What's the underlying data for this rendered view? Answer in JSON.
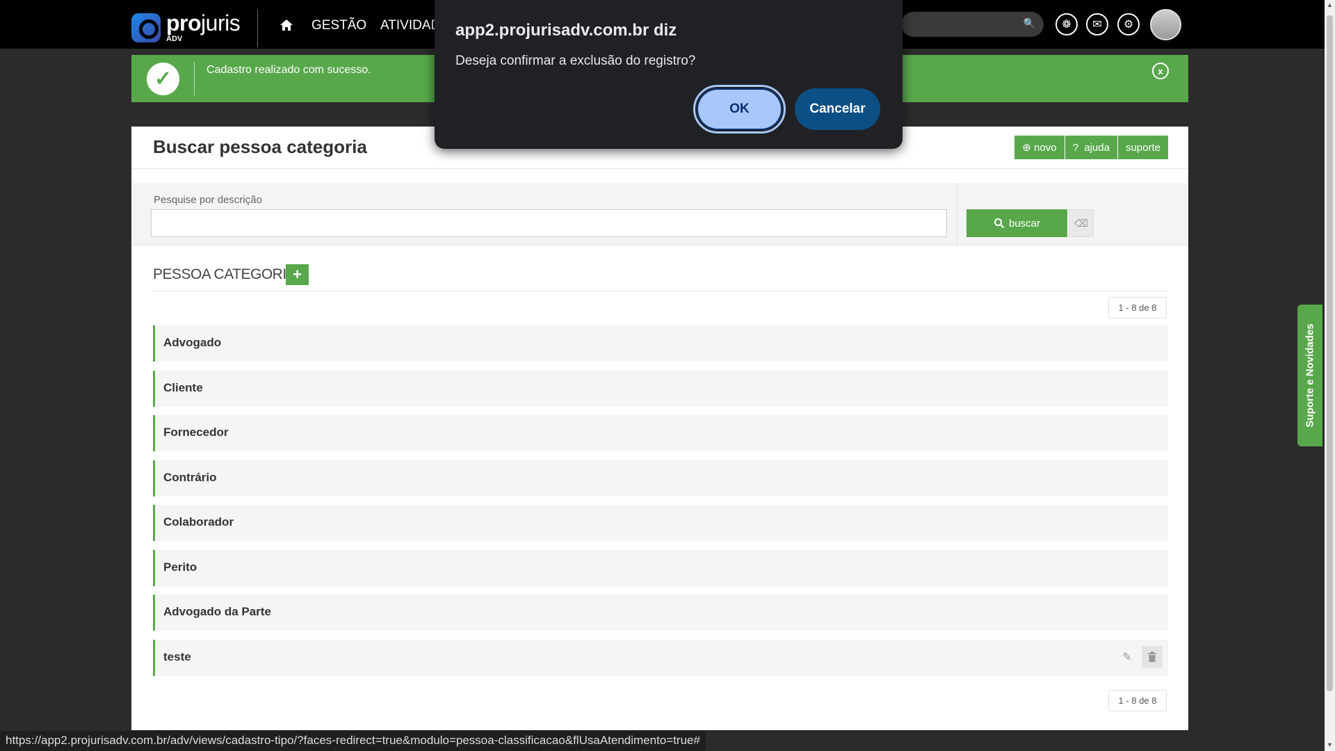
{
  "colors": {
    "accent_green": "#58a84b",
    "topbar": "#000000",
    "dialog_bg": "#202124",
    "ok_button": "#a8c7fa",
    "cancel_button": "#0b4f85"
  },
  "topbar": {
    "logo_name_bold": "pro",
    "logo_name_light": "juris",
    "logo_sub": "ADV",
    "nav": {
      "home_icon": "home-icon",
      "gestao": "GESTÃO",
      "atividades": "ATIVIDAD"
    },
    "icons": [
      "gear-badge-icon",
      "mail-icon",
      "settings-icon",
      "avatar"
    ]
  },
  "alert": {
    "message": "Cadastro realizado com sucesso.",
    "close": "x"
  },
  "panel": {
    "title": "Buscar pessoa categoria",
    "actions": {
      "novo": "novo",
      "ajuda": "ajuda",
      "suporte": "suporte"
    },
    "filter": {
      "label": "Pesquise por descrição",
      "value": "",
      "search_button": "buscar"
    },
    "section_title": "PESSOA CATEGORIA",
    "add_button": "+",
    "pager_top": "1 - 8 de 8",
    "pager_bottom": "1 - 8 de 8",
    "rows": [
      {
        "label": "Advogado"
      },
      {
        "label": "Cliente"
      },
      {
        "label": "Fornecedor"
      },
      {
        "label": "Contrário"
      },
      {
        "label": "Colaborador"
      },
      {
        "label": "Perito"
      },
      {
        "label": "Advogado da Parte"
      },
      {
        "label": "teste"
      }
    ]
  },
  "side_tab": "Suporte e Novidades",
  "status_url": "https://app2.projurisadv.com.br/adv/views/cadastro-tipo/?faces-redirect=true&modulo=pessoa-classificacao&flUsaAtendimento=true#",
  "dialog": {
    "title": "app2.projurisadv.com.br diz",
    "message": "Deseja confirmar a exclusão do registro?",
    "ok": "OK",
    "cancel": "Cancelar"
  }
}
